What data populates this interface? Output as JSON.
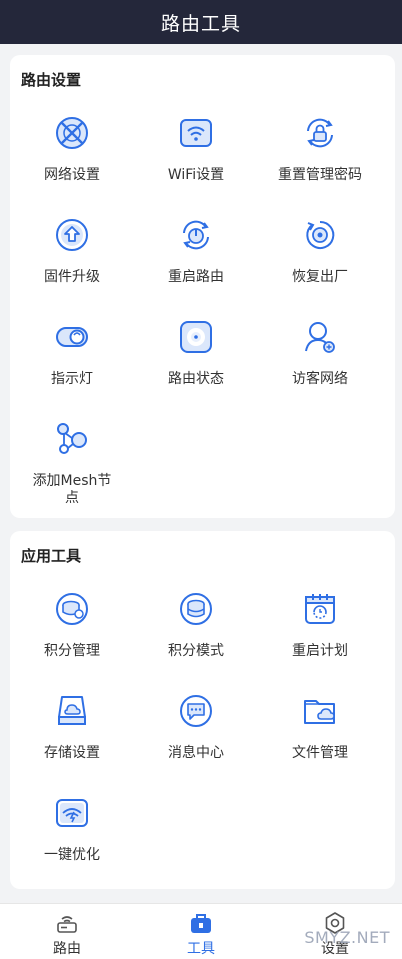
{
  "header": {
    "title": "路由工具"
  },
  "router_settings": {
    "title": "路由设置",
    "items": [
      {
        "label": "网络设置",
        "icon": "network-icon"
      },
      {
        "label": "WiFi设置",
        "icon": "wifi-icon"
      },
      {
        "label": "重置管理密码",
        "icon": "reset-password-icon"
      },
      {
        "label": "固件升级",
        "icon": "firmware-upgrade-icon"
      },
      {
        "label": "重启路由",
        "icon": "reboot-icon"
      },
      {
        "label": "恢复出厂",
        "icon": "factory-reset-icon"
      },
      {
        "label": "指示灯",
        "icon": "indicator-light-icon"
      },
      {
        "label": "路由状态",
        "icon": "router-status-icon"
      },
      {
        "label": "访客网络",
        "icon": "guest-network-icon"
      },
      {
        "label": "添加Mesh节点",
        "icon": "mesh-node-icon"
      }
    ]
  },
  "app_tools": {
    "title": "应用工具",
    "items": [
      {
        "label": "积分管理",
        "icon": "points-management-icon"
      },
      {
        "label": "积分模式",
        "icon": "points-mode-icon"
      },
      {
        "label": "重启计划",
        "icon": "reboot-schedule-icon"
      },
      {
        "label": "存储设置",
        "icon": "storage-icon"
      },
      {
        "label": "消息中心",
        "icon": "message-icon"
      },
      {
        "label": "文件管理",
        "icon": "file-manager-icon"
      },
      {
        "label": "一键优化",
        "icon": "optimize-icon"
      }
    ]
  },
  "tabbar": {
    "tabs": [
      {
        "label": "路由",
        "icon": "router-tab-icon",
        "active": false
      },
      {
        "label": "工具",
        "icon": "toolbox-tab-icon",
        "active": true
      },
      {
        "label": "设置",
        "icon": "settings-tab-icon",
        "active": false
      }
    ]
  },
  "watermark": "SMYZ.NET",
  "colors": {
    "accent": "#2f6fe4",
    "header": "#24273a",
    "icon_fill": "#dbe7fb"
  }
}
